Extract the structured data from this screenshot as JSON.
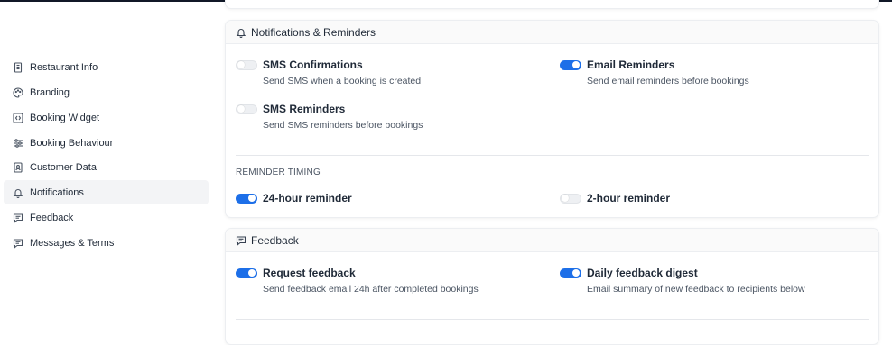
{
  "sidebar": {
    "items": [
      {
        "label": "Restaurant Info",
        "icon": "building-icon",
        "active": false
      },
      {
        "label": "Branding",
        "icon": "palette-icon",
        "active": false
      },
      {
        "label": "Booking Widget",
        "icon": "code-icon",
        "active": false
      },
      {
        "label": "Booking Behaviour",
        "icon": "sliders-icon",
        "active": false
      },
      {
        "label": "Customer Data",
        "icon": "id-card-icon",
        "active": false
      },
      {
        "label": "Notifications",
        "icon": "bell-icon",
        "active": true
      },
      {
        "label": "Feedback",
        "icon": "message-icon",
        "active": false
      },
      {
        "label": "Messages & Terms",
        "icon": "message-text-icon",
        "active": false
      }
    ]
  },
  "notifications": {
    "title": "Notifications & Reminders",
    "icon": "bell-icon",
    "options": [
      {
        "label": "SMS Confirmations",
        "description": "Send SMS when a booking is created",
        "enabled": false
      },
      {
        "label": "Email Reminders",
        "description": "Send email reminders before bookings",
        "enabled": true
      },
      {
        "label": "SMS Reminders",
        "description": "Send SMS reminders before bookings",
        "enabled": false
      }
    ],
    "timing_caption": "REMINDER TIMING",
    "timing": [
      {
        "label": "24-hour reminder",
        "enabled": true
      },
      {
        "label": "2-hour reminder",
        "enabled": false
      }
    ]
  },
  "feedback": {
    "title": "Feedback",
    "icon": "message-icon",
    "options": [
      {
        "label": "Request feedback",
        "description": "Send feedback email 24h after completed bookings",
        "enabled": true
      },
      {
        "label": "Daily feedback digest",
        "description": "Email summary of new feedback to recipients below",
        "enabled": true
      }
    ]
  },
  "colors": {
    "accent": "#1d6fe8",
    "toggle_off": "#eef0f3",
    "active_nav_bg": "#f3f4f6"
  }
}
